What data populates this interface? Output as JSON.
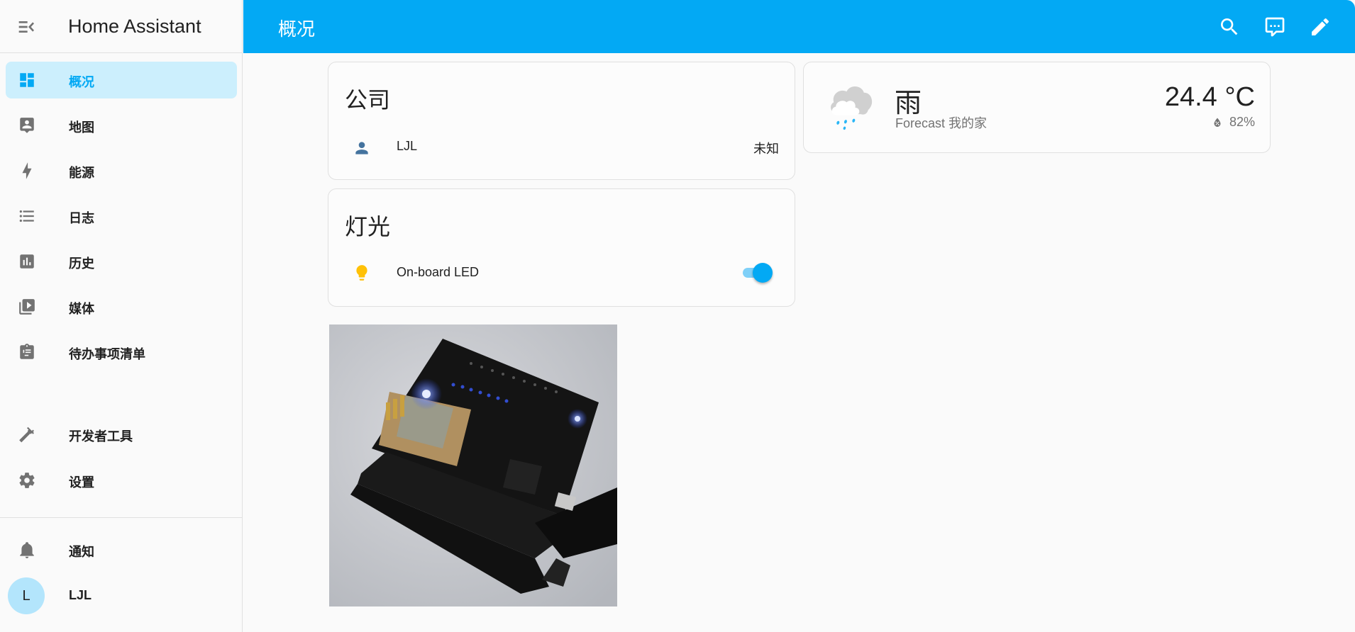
{
  "app": {
    "title": "Home Assistant",
    "menu_icon": "menu-collapse-icon"
  },
  "sidebar": {
    "items": [
      {
        "label": "概况",
        "icon": "dashboard-icon",
        "active": true
      },
      {
        "label": "地图",
        "icon": "map-account-icon",
        "active": false
      },
      {
        "label": "能源",
        "icon": "lightning-bolt-icon",
        "active": false
      },
      {
        "label": "日志",
        "icon": "logbook-list-icon",
        "active": false
      },
      {
        "label": "历史",
        "icon": "history-chart-icon",
        "active": false
      },
      {
        "label": "媒体",
        "icon": "media-play-icon",
        "active": false
      },
      {
        "label": "待办事项清单",
        "icon": "todo-clipboard-icon",
        "active": false
      }
    ],
    "bottom_items": [
      {
        "label": "开发者工具",
        "icon": "hammer-icon"
      },
      {
        "label": "设置",
        "icon": "gear-icon"
      }
    ],
    "notifications": {
      "label": "通知",
      "icon": "bell-icon"
    },
    "user": {
      "initial": "L",
      "name": "LJL"
    }
  },
  "header": {
    "title": "概况",
    "actions": [
      {
        "name": "search",
        "icon": "search-icon"
      },
      {
        "name": "assist",
        "icon": "assist-chat-icon"
      },
      {
        "name": "edit",
        "icon": "pencil-icon"
      }
    ]
  },
  "cards": {
    "company": {
      "title": "公司",
      "rows": [
        {
          "name": "LJL",
          "state": "未知",
          "icon": "person-icon"
        }
      ]
    },
    "lights": {
      "title": "灯光",
      "rows": [
        {
          "name": "On-board LED",
          "icon": "lightbulb-icon",
          "on": true
        }
      ]
    },
    "weather": {
      "condition": "雨",
      "name": "Forecast 我的家",
      "temperature": "24.4 °C",
      "humidity": "82%",
      "icon": "rainy-cloud-icon"
    },
    "picture": {
      "description": "NodeMCU ESP8266 board with blue LEDs lit"
    }
  },
  "colors": {
    "primary": "#03a9f4",
    "active_bg": "#cceffd",
    "person_icon": "#44739e",
    "light_on": "#ffc107",
    "avatar_bg": "#b3e5fc"
  }
}
